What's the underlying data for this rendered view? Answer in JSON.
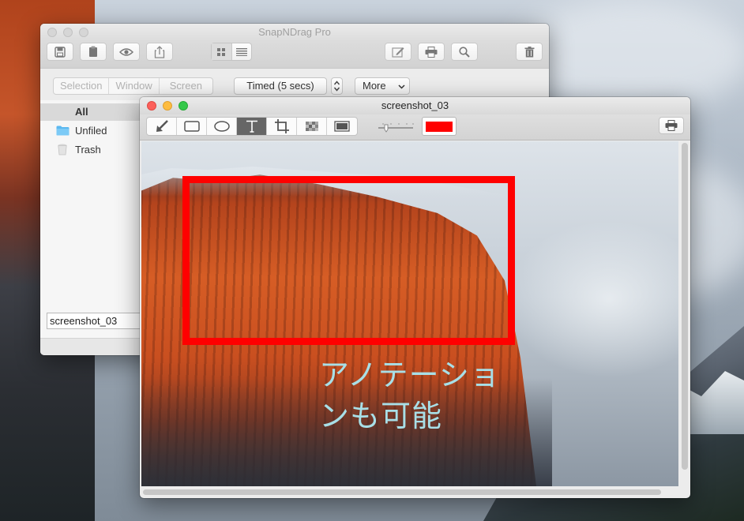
{
  "main_window": {
    "title": "SnapNDrag Pro",
    "toolbar": {
      "icons": [
        "save-icon",
        "clipboard-icon",
        "eye-icon",
        "share-icon",
        "grid-view-icon",
        "list-view-icon",
        "edit-icon",
        "print-icon",
        "search-icon",
        "trash-icon"
      ]
    },
    "capture": {
      "modes": [
        "Selection",
        "Window",
        "Screen"
      ],
      "timed_label": "Timed (5 secs)",
      "more_label": "More"
    },
    "sidebar": {
      "items": [
        {
          "label": "All",
          "icon": "none",
          "selected": true
        },
        {
          "label": "Unfiled",
          "icon": "folder-icon",
          "selected": false
        },
        {
          "label": "Trash",
          "icon": "trash-can-icon",
          "selected": false
        }
      ]
    },
    "name_field": "screenshot_03"
  },
  "doc_window": {
    "title": "screenshot_03",
    "tools": [
      "arrow-tool",
      "rectangle-tool",
      "ellipse-tool",
      "text-tool",
      "crop-tool",
      "pixelate-tool",
      "shadow-tool"
    ],
    "active_tool": "text-tool",
    "stroke_color": "#ff0000",
    "annotation_text_line1": "アノテーショ",
    "annotation_text_line2": "ンも可能",
    "annotation_text_color": "#a8dfe7"
  }
}
